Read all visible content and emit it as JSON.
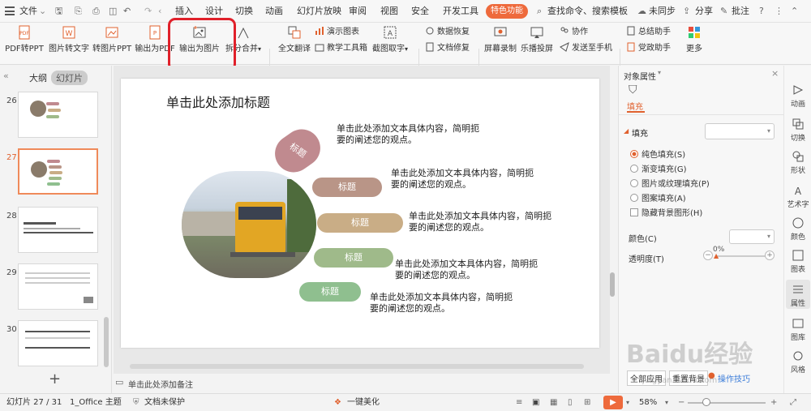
{
  "menubar": {
    "file": "文件",
    "tabs": [
      "插入",
      "设计",
      "切换",
      "动画",
      "幻灯片放映",
      "审阅",
      "视图",
      "安全",
      "开发工具"
    ],
    "feature_tab": "特色功能",
    "search": "查找命令、搜索模板",
    "sync": "未同步",
    "share": "分享",
    "annotate": "批注"
  },
  "ribbon": {
    "pdf_to_ppt": "PDF转PPT",
    "img_to_text": "图片转文字",
    "img_to_ppt": "转图片PPT",
    "export_pdf": "输出为PDF",
    "export_img": "输出为图片",
    "split_merge": "拆分合并",
    "full_translate": "全文翻译",
    "demo_chart": "演示图表",
    "teaching_tools": "教学工具箱",
    "screenshot_text": "截图取字",
    "data_recovery": "数据恢复",
    "doc_repair": "文档修复",
    "screen_record": "屏幕录制",
    "lebo_cast": "乐播投屏",
    "collab": "协作",
    "send_phone": "发送至手机",
    "summary": "总结助手",
    "party_gov": "党政助手",
    "more": "更多"
  },
  "left_panel": {
    "tab_outline": "大纲",
    "tab_slides": "幻灯片",
    "thumbs": [
      "26",
      "27",
      "28",
      "29",
      "30"
    ],
    "add": "+"
  },
  "slide": {
    "title": "单击此处添加标题",
    "pill_label": "标题",
    "body": "单击此处添加文本具体内容，简明扼要的阐述您的观点。",
    "colors": {
      "p1": "#c08a8f",
      "p2": "#b99587",
      "p3": "#c9ad86",
      "p4": "#9fba8a",
      "p5": "#8fbf8f"
    }
  },
  "notes": "单击此处添加备注",
  "right_panel": {
    "title": "对象属性",
    "tab_fill": "填充",
    "section_fill": "填充",
    "options": [
      "纯色填充(S)",
      "渐变填充(G)",
      "图片或纹理填充(P)",
      "图案填充(A)"
    ],
    "hide_bg": "隐藏背景图形(H)",
    "color_label": "颜色(C)",
    "transparency_label": "透明度(T)",
    "transparency_value": "0%",
    "apply_all": "全部应用",
    "reset_bg": "重置背景",
    "tips": "操作技巧"
  },
  "right_sidebar": [
    "动画",
    "切换",
    "形状",
    "艺术字",
    "颜色",
    "图表",
    "属性",
    "图库",
    "风格"
  ],
  "status": {
    "slide_info": "幻灯片 27 / 31",
    "theme": "1_Office 主题",
    "protect": "文档未保护",
    "beautify": "一键美化",
    "zoom": "58%"
  },
  "watermark": "Baidu经验",
  "watermark_url": "jingyan.baidu.com"
}
